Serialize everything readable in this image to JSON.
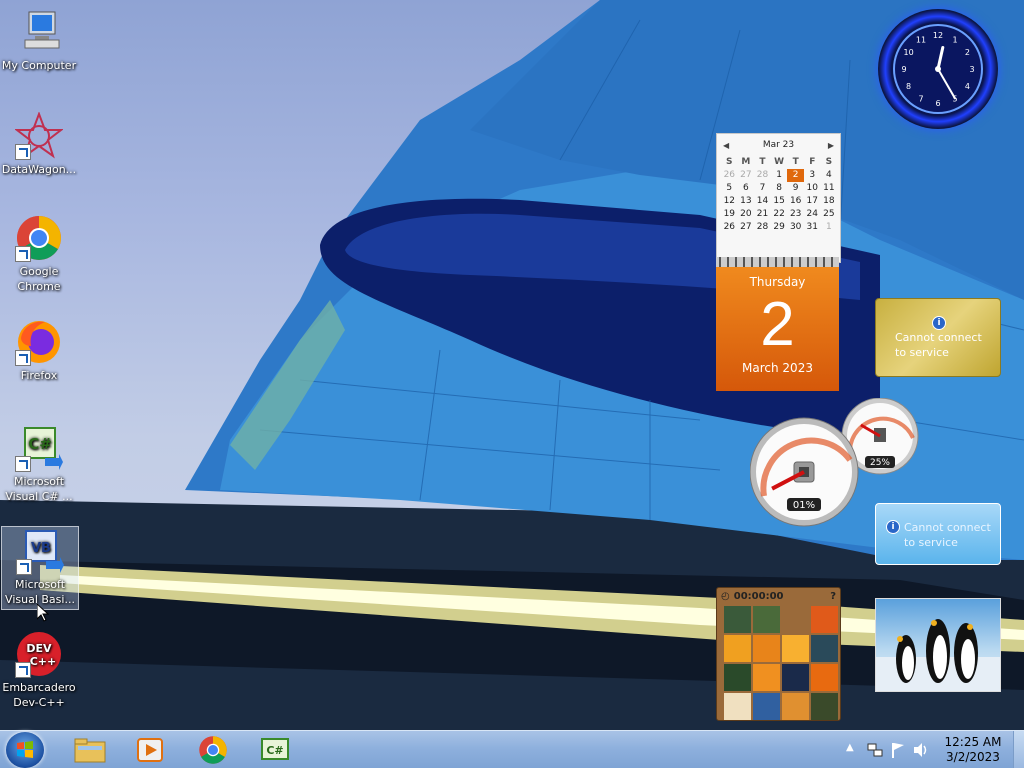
{
  "desktop_icons": [
    {
      "label": "My Computer",
      "icon": "computer-icon"
    },
    {
      "label": "DataWagon...",
      "icon": "datawagon-icon"
    },
    {
      "label": "Google Chrome",
      "icon": "chrome-icon"
    },
    {
      "label": "Firefox",
      "icon": "firefox-icon"
    },
    {
      "label": "Microsoft Visual C# ...",
      "icon": "visual-csharp-icon"
    },
    {
      "label": "Microsoft Visual Basi...",
      "icon": "visual-basic-icon"
    },
    {
      "label": "Embarcadero Dev-C++",
      "icon": "devcpp-icon"
    }
  ],
  "calendar": {
    "month_label": "Mar 23",
    "weekdays": [
      "S",
      "M",
      "T",
      "W",
      "T",
      "F",
      "S"
    ],
    "days": [
      [
        "26",
        "27",
        "28",
        "1",
        "2",
        "3",
        "4"
      ],
      [
        "5",
        "6",
        "7",
        "8",
        "9",
        "10",
        "11"
      ],
      [
        "12",
        "13",
        "14",
        "15",
        "16",
        "17",
        "18"
      ],
      [
        "19",
        "20",
        "21",
        "22",
        "23",
        "24",
        "25"
      ],
      [
        "26",
        "27",
        "28",
        "29",
        "30",
        "31",
        "1"
      ]
    ],
    "today": "2",
    "weekday_full": "Thursday",
    "day_number": "2",
    "month_year": "March 2023"
  },
  "feeds": {
    "feed1_text": "Cannot connect to service",
    "feed2_text": "Cannot connect to service"
  },
  "cpu_meter": {
    "cpu_percent": "01%",
    "memory_percent": "25%",
    "cpu_value": 0.01,
    "memory_value": 0.25
  },
  "puzzle": {
    "timer": "00:00:00"
  },
  "analog_clock": {
    "hour": 12,
    "minute": 25
  },
  "taskbar": {
    "apps": [
      "file-explorer-icon",
      "media-player-icon",
      "chrome-icon",
      "visual-csharp-icon"
    ],
    "time": "12:25 AM",
    "date": "3/2/2023"
  }
}
